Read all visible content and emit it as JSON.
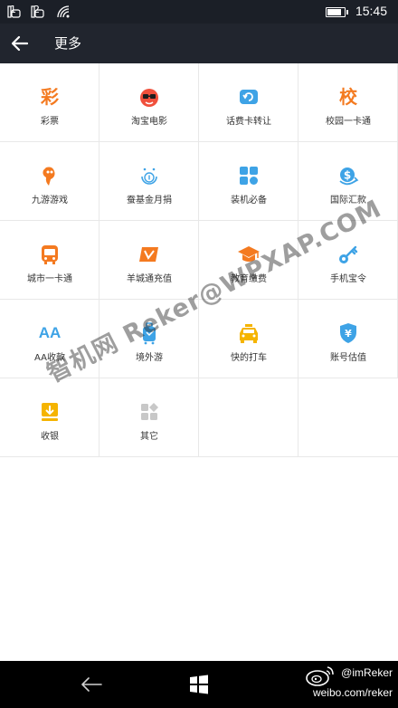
{
  "status_bar": {
    "signal_1": "1",
    "signal_2": "2",
    "time": "15:45",
    "battery_level": 0.9
  },
  "header": {
    "title": "更多"
  },
  "grid": {
    "items": [
      {
        "label": "彩票",
        "glyph": "彩",
        "icon": "lottery-icon",
        "color": "#f47a20"
      },
      {
        "label": "淘宝电影",
        "icon": "taobao-movie-icon",
        "color": "#f0503c"
      },
      {
        "label": "话费卡转让",
        "icon": "phone-card-transfer-icon",
        "color": "#3ea3e6"
      },
      {
        "label": "校园一卡通",
        "glyph": "校",
        "icon": "campus-card-icon",
        "color": "#f47a20"
      },
      {
        "label": "九游游戏",
        "icon": "jiuyou-game-icon",
        "color": "#f47a20"
      },
      {
        "label": "蚕基金月捐",
        "icon": "donation-icon",
        "color": "#3ea3e6"
      },
      {
        "label": "装机必备",
        "icon": "apps-essential-icon",
        "color": "#3ea3e6"
      },
      {
        "label": "国际汇款",
        "icon": "international-remittance-icon",
        "color": "#3ea3e6"
      },
      {
        "label": "城市一卡通",
        "icon": "city-card-icon",
        "color": "#f47a20"
      },
      {
        "label": "羊城通充值",
        "icon": "yangcheng-card-icon",
        "color": "#f47a20"
      },
      {
        "label": "教育缴费",
        "icon": "education-icon",
        "color": "#f47a20"
      },
      {
        "label": "手机宝令",
        "icon": "key-icon",
        "color": "#3ea3e6"
      },
      {
        "label": "AA收款",
        "glyph": "AA",
        "icon": "aa-collect-icon",
        "color": "#3ea3e6"
      },
      {
        "label": "境外游",
        "icon": "luggage-icon",
        "color": "#3ea3e6"
      },
      {
        "label": "快的打车",
        "icon": "taxi-icon",
        "color": "#f5b400"
      },
      {
        "label": "账号估值",
        "icon": "shield-yen-icon",
        "color": "#3ea3e6"
      },
      {
        "label": "收银",
        "icon": "download-icon",
        "color": "#f5b400"
      },
      {
        "label": "其它",
        "icon": "other-icon",
        "color": "#c8c8c8"
      }
    ]
  },
  "watermark": {
    "text": "智机网 Reker@WPXAP.COM"
  },
  "credit": {
    "handle": "@imReker",
    "url": "weibo.com/reker"
  }
}
